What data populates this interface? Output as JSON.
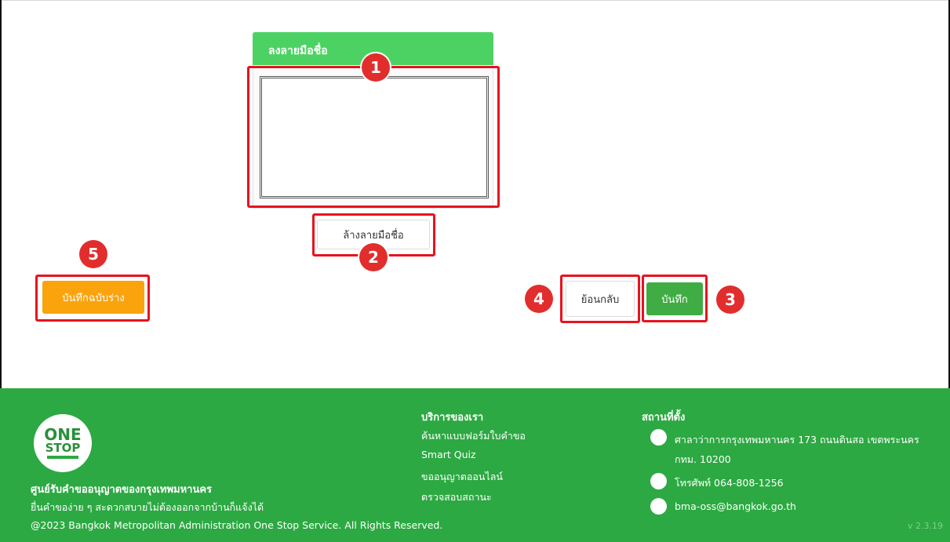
{
  "signature": {
    "header": "ลงลายมือชื่อ",
    "clear_label": "ล้างลายมือชื่อ"
  },
  "actions": {
    "back_label": "ย้อนกลับ",
    "save_label": "บันทึก",
    "draft_label": "บันทึกฉบับร่าง"
  },
  "badges": [
    "1",
    "2",
    "3",
    "4",
    "5"
  ],
  "footer": {
    "logo_top": "ONE",
    "logo_bottom": "STOP",
    "org_name": "ศูนย์รับคำขออนุญาตของกรุงเทพมหานคร",
    "tagline": "ยื่นคำของ่าย ๆ สะดวกสบายไม่ต้องออกจากบ้านก็แจ้งได้",
    "copyright": "@2023 Bangkok Metropolitan Administration One Stop Service. All Rights Reserved.",
    "services_title": "บริการของเรา",
    "services": [
      "ค้นหาแบบฟอร์มใบคำขอ",
      "Smart Quiz",
      "ขออนุญาตออนไลน์",
      "ตรวจสอบสถานะ"
    ],
    "location_title": "สถานที่ตั้ง",
    "address_line1": "ศาลาว่าการกรุงเทพมหานคร 173 ถนนดินสอ เขตพระนคร",
    "address_line2": "กทม. 10200",
    "phone": "โทรศัพท์ 064-808-1256",
    "email": "bma-oss@bangkok.go.th",
    "version": "v 2.3.19"
  },
  "colors": {
    "header_green": "#4cd263",
    "save_green": "#3fad43",
    "draft_orange": "#fba30c",
    "footer_green": "#2ca942",
    "badge_red": "#e22d2d",
    "highlight_red": "#e8121e"
  }
}
